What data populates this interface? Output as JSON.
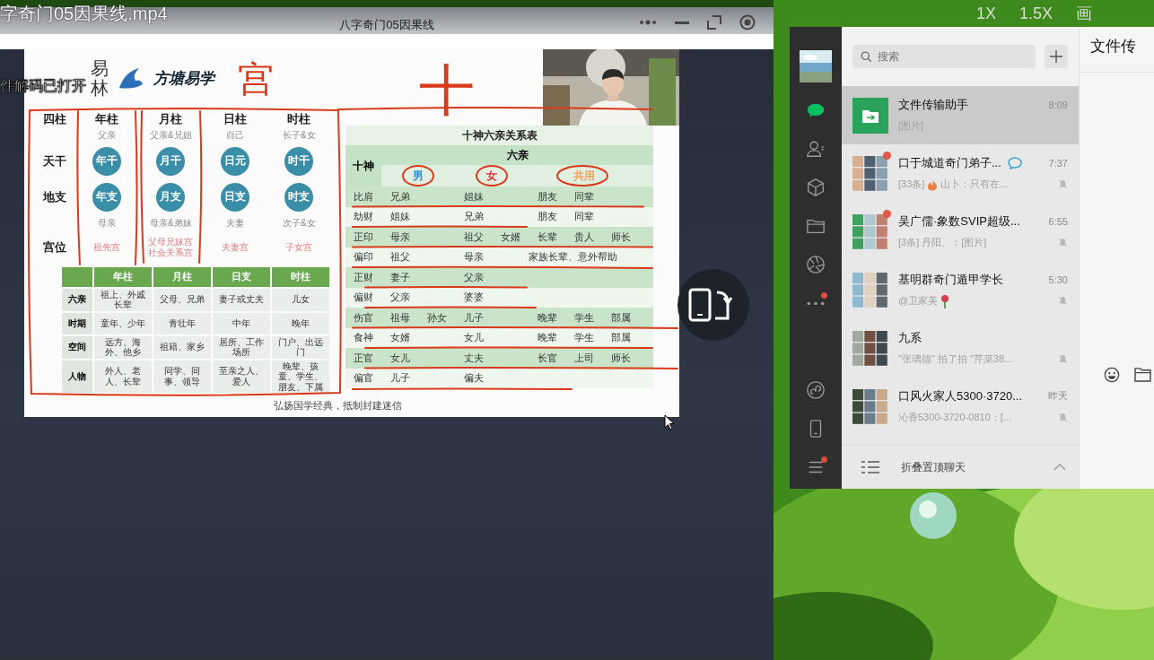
{
  "speed_options": [
    "1X",
    "1.5X",
    "画"
  ],
  "player": {
    "file_name": "字奇门05因果线.mp4",
    "title": "八字奇门05因果线",
    "toast": "件解码已打开"
  },
  "slide": {
    "brand_vertical": "易林",
    "brand": "方塘易学",
    "handwriting": [
      "宫",
      "十"
    ],
    "pillars": {
      "corner": "四柱",
      "columns": [
        "年柱",
        "月柱",
        "日柱",
        "时柱"
      ],
      "stem_relations": [
        "父亲",
        "父亲&兄姐",
        "自己",
        "长子&女"
      ],
      "stem_row": {
        "label": "天干",
        "circles": [
          "年干",
          "月干",
          "日元",
          "时干"
        ]
      },
      "branch_row": {
        "label": "地支",
        "circles": [
          "年支",
          "月支",
          "日支",
          "时支"
        ]
      },
      "branch_relations": [
        "母亲",
        "母亲&弟妹",
        "夫妻",
        "次子&女"
      ],
      "palace": {
        "label": "宫位",
        "values": [
          "祖先宫",
          "父母兄妹宫社会关系宫",
          "夫妻宫",
          "子女宫"
        ]
      }
    },
    "period_table": {
      "columns": [
        "年柱",
        "月柱",
        "日支",
        "时柱"
      ],
      "rows": [
        {
          "label": "六亲",
          "cells": [
            "祖上、外戚长辈",
            "父母、兄弟",
            "妻子或丈夫",
            "儿女"
          ]
        },
        {
          "label": "时期",
          "cells": [
            "童年、少年",
            "青壮年",
            "中年",
            "晚年"
          ]
        },
        {
          "label": "空间",
          "cells": [
            "远方、海外、他乡",
            "祖籍、家乡",
            "居所、工作场所",
            "门户、出远门"
          ]
        },
        {
          "label": "人物",
          "cells": [
            "外人、老人、长辈",
            "同学、同事、领导",
            "至亲之人、爱人",
            "晚辈、孩童、学生、朋友、下属"
          ]
        }
      ]
    },
    "footer": "弘扬国学经典，抵制封建迷信",
    "relations_table": {
      "title": "十神六亲关系表",
      "head_left": "十神",
      "head_group": "六亲",
      "subheads": [
        {
          "label": "男",
          "color": "#2f8fd8"
        },
        {
          "label": "女",
          "color": "#e0303a"
        },
        {
          "label": "共用",
          "color": "#f0a050"
        }
      ],
      "rows": [
        {
          "name": "比肩",
          "male": [
            "兄弟"
          ],
          "female": [
            "姐妹"
          ],
          "common": [
            "朋友",
            "同辈"
          ]
        },
        {
          "name": "劫财",
          "male": [
            "姐妹"
          ],
          "female": [
            "兄弟"
          ],
          "common": [
            "朋友",
            "同辈"
          ]
        },
        {
          "name": "正印",
          "male": [
            "母亲"
          ],
          "female": [
            "祖父",
            "女婿"
          ],
          "common": [
            "长辈",
            "贵人",
            "师长"
          ]
        },
        {
          "name": "偏印",
          "male": [
            "祖父"
          ],
          "female": [
            "母亲"
          ],
          "common": [
            "家族长辈、意外帮助"
          ]
        },
        {
          "name": "正财",
          "male": [
            "妻子"
          ],
          "female": [
            "父亲"
          ]
        },
        {
          "name": "偏财",
          "male": [
            "父亲"
          ],
          "female": [
            "婆婆"
          ]
        },
        {
          "name": "伤官",
          "male": [
            "祖母",
            "孙女"
          ],
          "female": [
            "儿子"
          ],
          "common": [
            "晚辈",
            "学生",
            "部属"
          ]
        },
        {
          "name": "食神",
          "male": [
            "女婿"
          ],
          "female": [
            "女儿"
          ],
          "common": [
            "晚辈",
            "学生",
            "部属"
          ]
        },
        {
          "name": "正官",
          "male": [
            "女儿"
          ],
          "female": [
            "丈夫"
          ],
          "common": [
            "长官",
            "上司",
            "师长"
          ]
        },
        {
          "name": "偏官",
          "male": [
            "儿子"
          ],
          "female": [
            "偏夫"
          ]
        }
      ]
    }
  },
  "wechat": {
    "search_placeholder": "搜索",
    "pane_title": "文件传",
    "fold_label": "折叠置顶聊天",
    "nav_top": [
      {
        "kind": "chat",
        "selected": true,
        "dot": false
      },
      {
        "kind": "contacts",
        "selected": false,
        "dot": false
      },
      {
        "kind": "box",
        "selected": false,
        "dot": false
      },
      {
        "kind": "folder",
        "selected": false,
        "dot": false
      },
      {
        "kind": "aperture",
        "selected": false,
        "dot": false
      },
      {
        "kind": "more",
        "selected": false,
        "dot": true
      }
    ],
    "nav_bottom": [
      {
        "kind": "miniapp",
        "selected": false,
        "dot": false
      },
      {
        "kind": "phone",
        "selected": false,
        "dot": false
      },
      {
        "kind": "menu",
        "selected": false,
        "dot": true
      }
    ],
    "chats": [
      {
        "kind": "file",
        "name": "文件传输助手",
        "time": "8:09",
        "preview": "[图片]",
        "selected": true,
        "unread": false,
        "muted": false
      },
      {
        "kind": "group",
        "name": "口于城道奇门弟子...",
        "mention": true,
        "time": "7:37",
        "preview": "[33条]",
        "emoji": {
          "kind": "fire"
        },
        "preview_tail": "山卜：只有在...",
        "selected": false,
        "unread": true,
        "muted": true
      },
      {
        "kind": "group",
        "name": "吴广儒·象数SVIP超级...",
        "time": "6:55",
        "preview": "[3条] 丹阳、：[图片]",
        "selected": false,
        "unread": true,
        "muted": true
      },
      {
        "kind": "group",
        "name": "基明群奇门遁甲学长",
        "time": "5:30",
        "preview": "@卫家美",
        "emoji": {
          "kind": "rose"
        },
        "selected": false,
        "unread": false,
        "muted": true
      },
      {
        "kind": "group",
        "name": "九系",
        "preview": "\"张璃德\" 拍了拍 \"芹菜38...",
        "selected": false,
        "unread": false,
        "muted": true
      },
      {
        "kind": "group",
        "name": "口风火家人5300·3720...",
        "time": "昨天",
        "preview": "沁香5300-3720-0810：[...",
        "selected": false,
        "unread": false,
        "muted": true
      }
    ]
  }
}
